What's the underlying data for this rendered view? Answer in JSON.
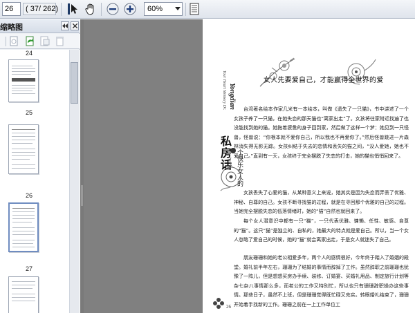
{
  "toolbar": {
    "page_number": "26",
    "page_of": "( 37/ 262)",
    "zoom": "60%",
    "icons": [
      "select-tool-icon",
      "hand-tool-icon",
      "zoom-out-icon",
      "zoom-in-icon",
      "chevron-down-icon",
      "fit-page-icon",
      "fit-width-icon"
    ]
  },
  "sidebar": {
    "title": "缩略图",
    "pages": [
      {
        "label": "24"
      },
      {
        "label": "25"
      },
      {
        "label": "26"
      },
      {
        "label": "27"
      }
    ]
  },
  "document": {
    "side_heading_en": "Your Heart Memory Dr.",
    "side_heading": "Yongdian",
    "side_heading_cn": "私房话",
    "side_subtitle": "个快乐女人的",
    "title": "女人先要爱自己，才能赢得全世界的爱",
    "paragraphs": [
      "台湾著名绘本作家几米有一本绘本，叫做《遗失了一只猫》，书中讲述了一个女孩子养了一只猫，在她失恋的那天猫也“离家出走”了。女孩将往家附近找遍了也没能找到她的猫。她拖着疲惫的身子回到家，然后做了这样一个梦：她见到一只怪兽，怪兽说：“你根本就不爱你自己，所以我也不再爱你了。”然后怪兽跳进一片森林消失得无影无踪。女孩纠结于失去的恋情和丢失的猫之间，“没人爱她，她也不爱自己。”直到有一天，女孩终于完全摆脱了失恋的打击，她的猫也悄悄回来了。",
      "女孩丢失了心爱的猫，从某种意义上来说，她其实是因为失恋而弄丢了优雅、神秘、自尊的自己。女孩不断寻找猫的过程，就是在寻回那个优雅的自己的过程。当她完全摆脱失恋的低落情绪时，她的“猫”自然也就回来了。",
      "每个女人潜意识中都有一只“猫”，一只代表优雅、慵懒、任性、敏感、自尊的“猫”。这只“猫”是独立的、自私的，她最大的特点就是爱自己。所以，当一个女人忽略了爱自己的时候，她的“猫”就会离家出走，于是女人就迷失了自己。",
      "朋友珊珊和她的老公相爱多年，两个人的感情很好，今年终于踏入了婚姻的殿堂。婚礼前半年左右，珊珊为了结婚的事情而辞掉了工作。虽然辞职之前珊珊也犹豫了一阵儿，但是想想买房办手续、装修、订婚宴、买婚礼用品、制定旅行计划等杂七杂八事情那么多，而老公的工作又特别忙，所以也只有珊珊辞职操办这些事情。那些日子，虽然不上班，但是珊珊觉得既忙碌又充实。转眼婚礼结束了，珊珊开始着手找新的工作。珊珊之前在一上工作单位工"
    ],
    "page_number": "26"
  }
}
